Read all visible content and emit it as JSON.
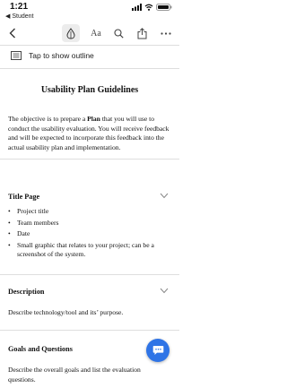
{
  "status": {
    "time": "1:21",
    "back_app": "◀ Student"
  },
  "toolbar": {
    "font_label": "Aa"
  },
  "outline": {
    "label": "Tap to show outline"
  },
  "document": {
    "title": "Usability Plan Guidelines",
    "intro_pre": "The objective is to prepare a ",
    "intro_bold": "Plan",
    "intro_post": " that you will use to conduct the usability evaluation. You will receive feedback and will be expected to incorporate this feedback into the actual usability plan and implementation.",
    "sections": [
      {
        "title": "Title Page",
        "bullets": [
          "Project title",
          "Team members",
          "Date",
          "Small graphic that relates to your project; can be a screenshot of the system."
        ]
      },
      {
        "title": "Description",
        "body": "Describe technology/tool and its’ purpose."
      },
      {
        "title": "Goals and Questions",
        "body": "Describe the overall goals and list the evaluation questions."
      }
    ]
  },
  "colors": {
    "accent": "#2f74e6"
  }
}
